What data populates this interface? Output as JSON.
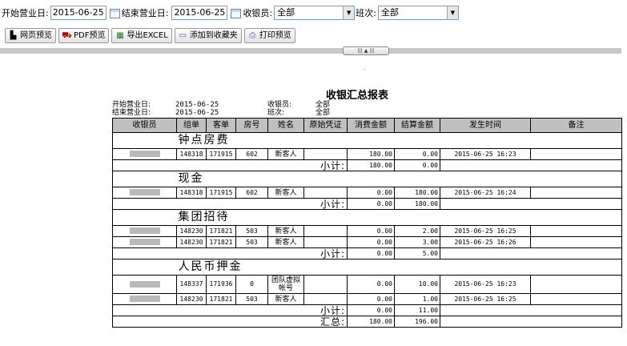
{
  "filters": {
    "start_label": "开始营业日:",
    "start_value": "2015-06-25",
    "end_label": "结束营业日:",
    "end_value": "2015-06-25",
    "cashier_label": "收银员:",
    "cashier_value": "全部",
    "shift_label": "班次:",
    "shift_value": "全部"
  },
  "toolbar": {
    "web_preview": "网页预览",
    "pdf_preview": "PDF预览",
    "export_excel": "导出EXCEL",
    "add_favorite": "添加到收藏夹",
    "print_preview": "打印预览"
  },
  "report": {
    "title": "收银汇总报表",
    "meta": {
      "start_label": "开始营业日:",
      "start_value": "2015-06-25",
      "end_label": "结束营业日:",
      "end_value": "2015-06-25",
      "cashier_label": "收银员:",
      "cashier_value": "全部",
      "shift_label": "班次:",
      "shift_value": "全部"
    },
    "columns": [
      "收银员",
      "组单",
      "客单",
      "房号",
      "姓名",
      "原始凭证",
      "消费金额",
      "结算金额",
      "发生时间",
      "备注"
    ],
    "groups": [
      {
        "name": "钟点房费",
        "rows": [
          {
            "group_no": "148318",
            "guest_no": "171915",
            "room": "602",
            "name": "新客人",
            "voucher": "",
            "consume": "180.00",
            "settle": "0.00",
            "time": "2015-06-25 16:23",
            "note": ""
          }
        ],
        "subtotal_label": "小计:",
        "subtotal_consume": "180.00",
        "subtotal_settle": "0.00"
      },
      {
        "name": "现金",
        "rows": [
          {
            "group_no": "148318",
            "guest_no": "171915",
            "room": "602",
            "name": "新客人",
            "voucher": "",
            "consume": "0.00",
            "settle": "180.00",
            "time": "2015-06-25 16:24",
            "note": ""
          }
        ],
        "subtotal_label": "小计:",
        "subtotal_consume": "0.00",
        "subtotal_settle": "180.00"
      },
      {
        "name": "集团招待",
        "rows": [
          {
            "group_no": "148230",
            "guest_no": "171821",
            "room": "503",
            "name": "新客人",
            "voucher": "",
            "consume": "0.00",
            "settle": "2.00",
            "time": "2015-06-25 16:25",
            "note": ""
          },
          {
            "group_no": "148230",
            "guest_no": "171821",
            "room": "503",
            "name": "新客人",
            "voucher": "",
            "consume": "0.00",
            "settle": "3.00",
            "time": "2015-06-25 16:26",
            "note": ""
          }
        ],
        "subtotal_label": "小计:",
        "subtotal_consume": "0.00",
        "subtotal_settle": "5.00"
      },
      {
        "name": "人民币押金",
        "rows": [
          {
            "group_no": "148337",
            "guest_no": "171936",
            "room": "0",
            "name": "团队虚拟帐号",
            "voucher": "",
            "consume": "0.00",
            "settle": "10.00",
            "time": "2015-06-25 16:23",
            "note": ""
          },
          {
            "group_no": "148230",
            "guest_no": "171821",
            "room": "503",
            "name": "新客人",
            "voucher": "",
            "consume": "0.00",
            "settle": "1.00",
            "time": "2015-06-25 16:25",
            "note": ""
          }
        ],
        "subtotal_label": "小计:",
        "subtotal_consume": "0.00",
        "subtotal_settle": "11.00"
      }
    ],
    "total_label": "汇总:",
    "total_consume": "180.00",
    "total_settle": "196.00"
  },
  "icons": {
    "calendar": "calendar-icon",
    "dropdown": "chevron-down-icon",
    "web": "web-preview-icon",
    "pdf": "pdf-icon",
    "excel": "excel-icon",
    "favorite": "favorite-icon",
    "print": "printer-icon"
  }
}
